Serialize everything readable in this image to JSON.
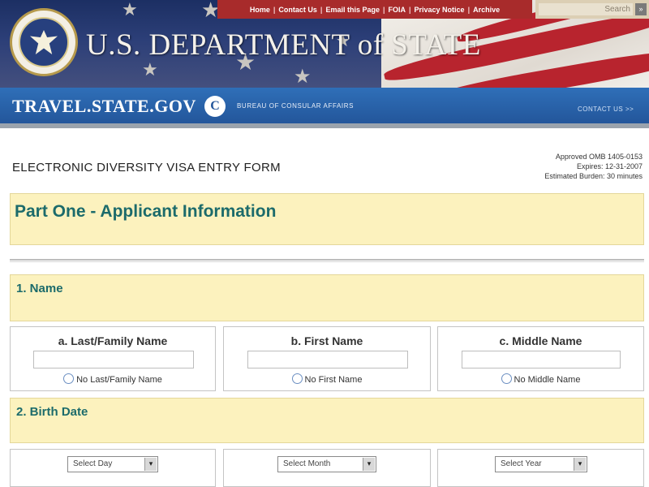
{
  "header": {
    "department_title": "U.S. DEPARTMENT of STATE",
    "nav": [
      "Home",
      "Contact Us",
      "Email this Page",
      "FOIA",
      "Privacy Notice",
      "Archive"
    ],
    "search_placeholder": "Search",
    "search_button": "»"
  },
  "travel_bar": {
    "logo": "TRAVEL.STATE.GOV",
    "bureau": "BUREAU OF CONSULAR AFFAIRS",
    "contact": "CONTACT US >>"
  },
  "form": {
    "heading": "ELECTRONIC DIVERSITY VISA ENTRY FORM",
    "omb": [
      "Approved OMB 1405-0153",
      "Expires: 12-31-2007",
      "Estimated Burden: 30 minutes"
    ],
    "part_title": "Part One - Applicant Information",
    "section_name": "1. Name",
    "name_fields": [
      {
        "label": "a. Last/Family Name",
        "checkbox": "No Last/Family Name"
      },
      {
        "label": "b. First Name",
        "checkbox": "No First Name"
      },
      {
        "label": "c. Middle Name",
        "checkbox": "No Middle Name"
      }
    ],
    "section_birth": "2. Birth Date",
    "birth_selects": [
      "Select Day",
      "Select Month",
      "Select Year"
    ]
  },
  "colors": {
    "section_title": "#1c6b6b",
    "section_background": "#fcf2be",
    "nav_background": "#a82b2b",
    "travel_bar": "#2a62a8"
  }
}
